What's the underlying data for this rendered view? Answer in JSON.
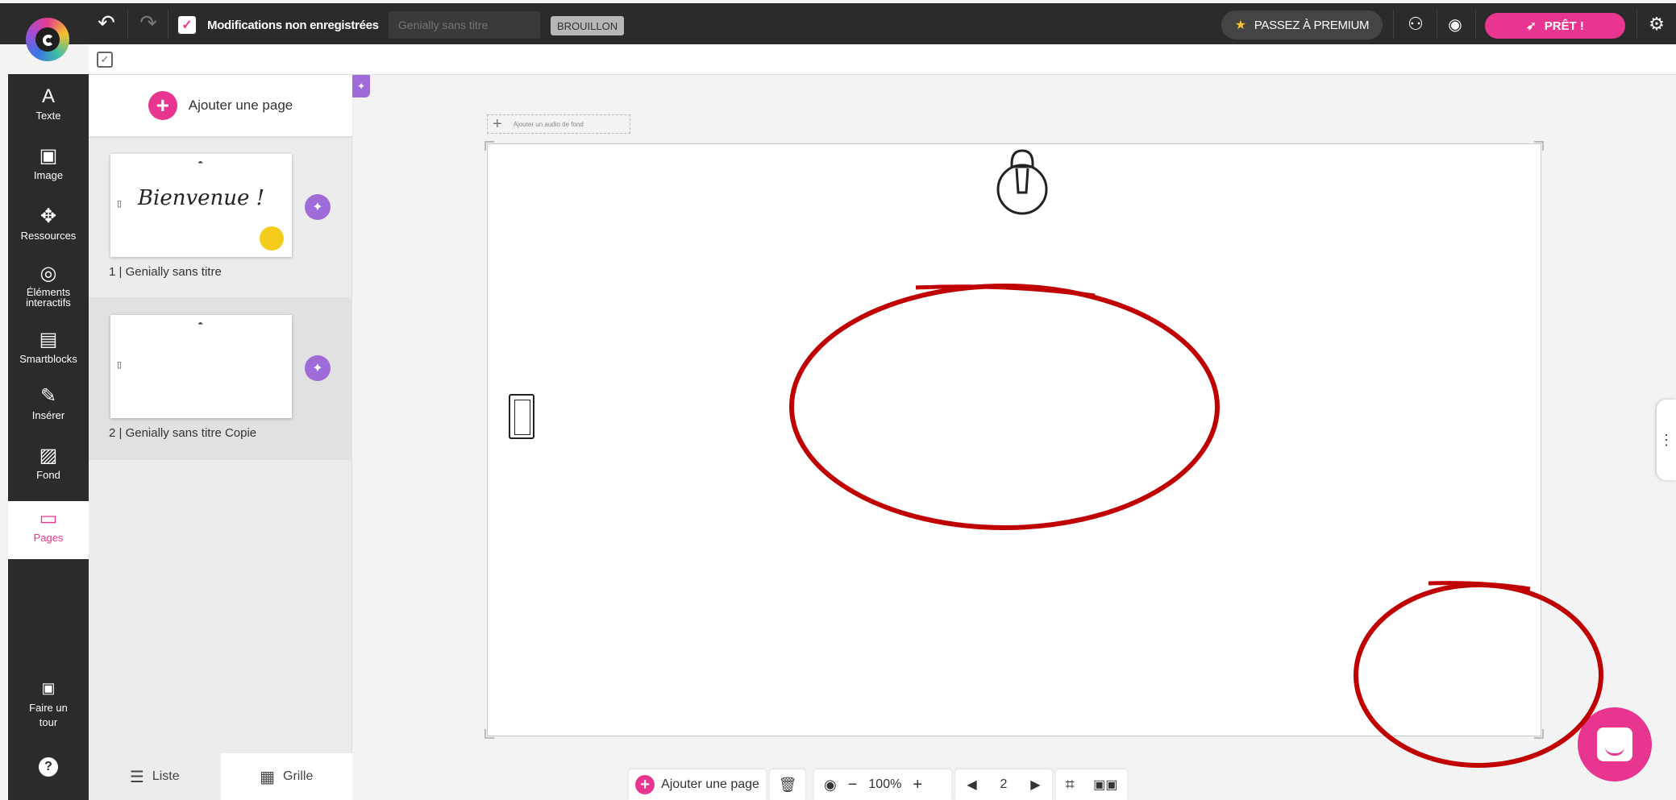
{
  "topbar": {
    "undo_icon": "undo-icon",
    "redo_icon": "redo-icon",
    "save_status": "Modifications non enregistrées",
    "title_placeholder": "Genially sans titre",
    "draft_badge": "BROUILLON",
    "premium_label": "PASSEZ À PREMIUM",
    "ready_label": "PRÊT !"
  },
  "leftnav": {
    "items": [
      {
        "label": "Texte",
        "icon": "A"
      },
      {
        "label": "Image",
        "icon": "▣"
      },
      {
        "label": "Ressources",
        "icon": "✥"
      },
      {
        "label": "Éléments interactifs",
        "icon": "◎"
      },
      {
        "label": "Smartblocks",
        "icon": "▤"
      },
      {
        "label": "Insérer",
        "icon": "✎"
      },
      {
        "label": "Fond",
        "icon": "▨"
      },
      {
        "label": "Pages",
        "icon": "▭"
      }
    ],
    "tour_label": "Faire un tour",
    "help_icon": "?"
  },
  "panel": {
    "add_page_label": "Ajouter une page",
    "pages": [
      {
        "caption": "1 | Genially sans titre",
        "thumb_text": "Bienvenue !"
      },
      {
        "caption": "2 | Genially sans titre Copie",
        "thumb_text": ""
      }
    ],
    "view_list": "Liste",
    "view_grid": "Grille"
  },
  "canvas": {
    "audio_label": "Ajouter un audio de fond"
  },
  "bottom": {
    "add_page_label": "Ajouter une page",
    "zoom_value": "100%",
    "page_number": "2"
  },
  "colors": {
    "accent": "#e8358f",
    "dark": "#2b2b2b",
    "purple": "#9e6bd9",
    "annotation_red": "#c00000"
  }
}
